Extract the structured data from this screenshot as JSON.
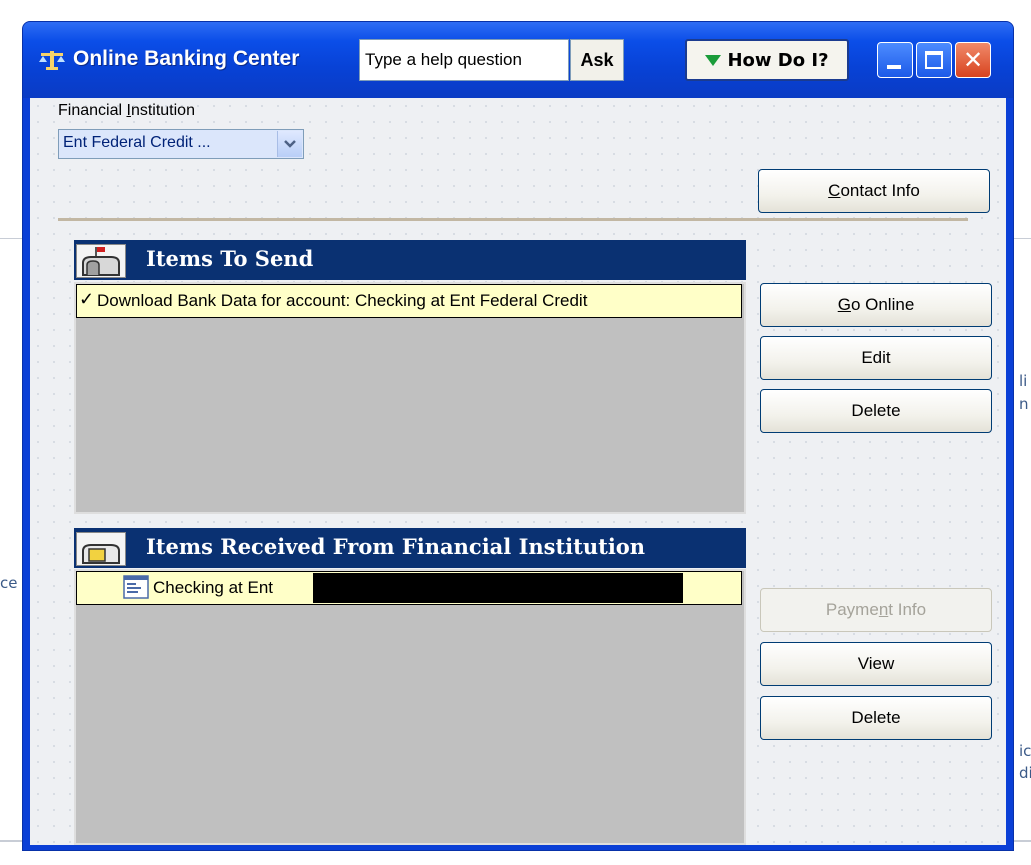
{
  "window": {
    "title": "Online Banking Center",
    "help_placeholder": "Type a help question",
    "ask_label": "Ask",
    "how_do_i_label": "How Do I?"
  },
  "background_fragments": [
    "ce",
    "li",
    "n",
    "ic",
    "di"
  ],
  "financial_institution": {
    "label_pre": "Financial ",
    "label_u": "I",
    "label_post": "nstitution",
    "selected_value": "Ent Federal Credit ..."
  },
  "buttons": {
    "contact_info": {
      "u": "C",
      "rest": "ontact Info"
    },
    "go_online": {
      "u": "G",
      "rest": "o Online"
    },
    "edit": "Edit",
    "delete_send": "Delete",
    "payment_info": {
      "pre": "Payme",
      "u": "n",
      "post": "t Info",
      "enabled": false
    },
    "view": "View",
    "delete_received": "Delete"
  },
  "items_to_send": {
    "title": "Items To Send",
    "rows": [
      {
        "checked": true,
        "text": "Download Bank Data for account: Checking at Ent Federal Credit"
      }
    ]
  },
  "items_received": {
    "title": "Items Received From Financial Institution",
    "rows": [
      {
        "text": "Checking at Ent"
      }
    ]
  },
  "colors": {
    "titlebar": "#0842d6",
    "panel_header": "#0a3172",
    "selected_row": "#ffffc8",
    "list_bg": "#c0c0c0"
  }
}
